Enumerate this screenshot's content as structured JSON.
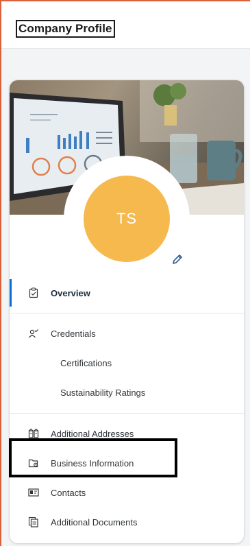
{
  "header": {
    "title": "Company Profile"
  },
  "profile": {
    "initials": "TS",
    "avatar_color": "#f5b94d",
    "edit_icon": "pencil-icon"
  },
  "nav": {
    "overview": {
      "label": "Overview",
      "icon": "clipboard-check-icon",
      "active": true
    },
    "credentials": {
      "label": "Credentials",
      "icon": "user-check-icon"
    },
    "certifications": {
      "label": "Certifications"
    },
    "sustainability": {
      "label": "Sustainability Ratings"
    },
    "addresses": {
      "label": "Additional Addresses",
      "icon": "buildings-icon"
    },
    "business": {
      "label": "Business Information",
      "icon": "folder-gear-icon"
    },
    "contacts": {
      "label": "Contacts",
      "icon": "contact-card-icon"
    },
    "documents": {
      "label": "Additional Documents",
      "icon": "documents-icon"
    }
  },
  "colors": {
    "accent": "#0a6ed1",
    "frame_border": "#d9623a"
  }
}
